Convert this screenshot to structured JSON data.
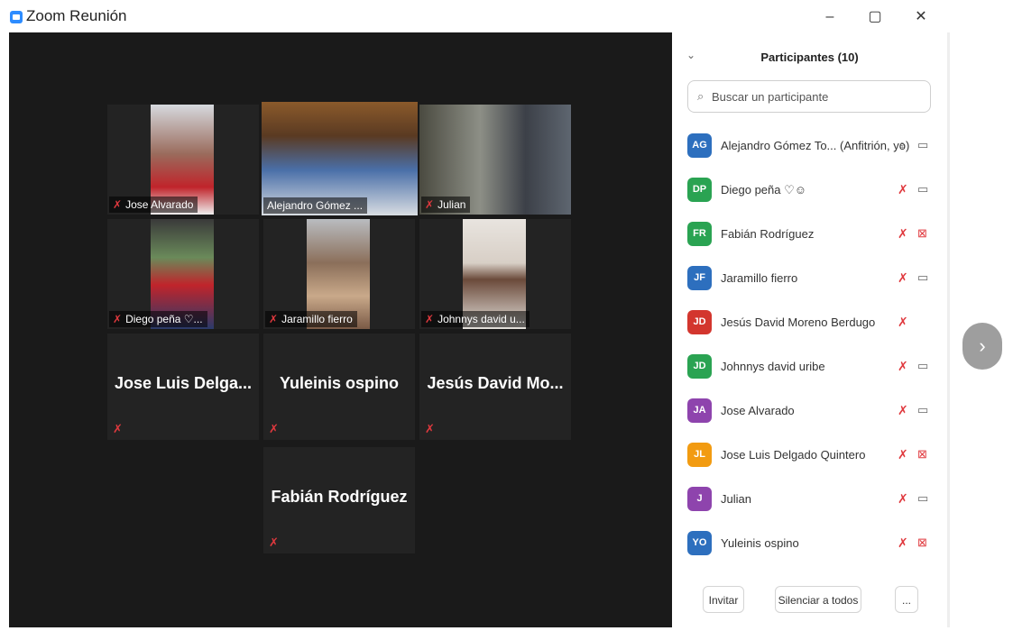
{
  "window": {
    "title": "Zoom Reunión",
    "minimize": "–",
    "restore": "▢",
    "close": "✕"
  },
  "panel": {
    "title": "Participantes (10)",
    "collapse": "⌄",
    "search_placeholder": "Buscar un participante",
    "search_icon": "⌕"
  },
  "tiles": [
    {
      "name": "Jose Alvarado",
      "video": true
    },
    {
      "name": "Alejandro Gómez ...",
      "video": true,
      "active": true
    },
    {
      "name": "Julian",
      "video": true
    },
    {
      "name": "Diego peña ♡...",
      "video": true
    },
    {
      "name": "Jaramillo fierro",
      "video": true
    },
    {
      "name": "Johnnys david u...",
      "video": true
    },
    {
      "name": "Jose Luis Delga...",
      "video": false
    },
    {
      "name": "Yuleinis ospino",
      "video": false
    },
    {
      "name": "Jesús David Mo...",
      "video": false
    },
    {
      "name": "Fabián Rodríguez",
      "video": false
    }
  ],
  "participants": [
    {
      "initials": "AG",
      "name": "Alejandro Gómez  To... (Anfitrión, yo)",
      "color": "#2d6fbe",
      "mic": "on",
      "cam": "on"
    },
    {
      "initials": "DP",
      "name": "Diego peña ♡☺",
      "color": "#2aa352",
      "mic": "off",
      "cam": "on"
    },
    {
      "initials": "FR",
      "name": "Fabián Rodríguez",
      "color": "#2aa352",
      "mic": "off",
      "cam": "off"
    },
    {
      "initials": "JF",
      "name": "Jaramillo fierro",
      "color": "#2d6fbe",
      "mic": "off",
      "cam": "on"
    },
    {
      "initials": "JD",
      "name": "Jesús David Moreno Berdugo",
      "color": "#d3362e",
      "mic": "off",
      "cam": "none"
    },
    {
      "initials": "JD",
      "name": "Johnnys david uribe",
      "color": "#2aa352",
      "mic": "off",
      "cam": "on"
    },
    {
      "initials": "JA",
      "name": "Jose Alvarado",
      "color": "#8e44ad",
      "mic": "off",
      "cam": "on"
    },
    {
      "initials": "JL",
      "name": "Jose Luis Delgado Quintero",
      "color": "#f29b11",
      "mic": "off",
      "cam": "off"
    },
    {
      "initials": "J",
      "name": "Julian",
      "color": "#8e44ad",
      "mic": "off",
      "cam": "on"
    },
    {
      "initials": "YO",
      "name": "Yuleinis ospino",
      "color": "#2d6fbe",
      "mic": "off",
      "cam": "off"
    }
  ],
  "footer": {
    "invite": "Invitar",
    "mute_all": "Silenciar a todos",
    "more": "..."
  },
  "icons": {
    "mic_muted": "✗",
    "mic_on": "♀",
    "cam_on": "▭",
    "cam_off": "⊠",
    "next": "›"
  }
}
